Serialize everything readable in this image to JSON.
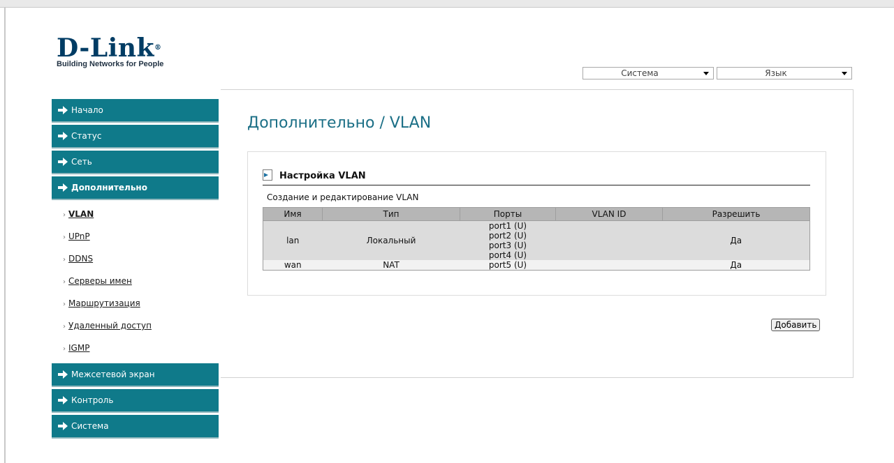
{
  "brand": {
    "name": "D-Link",
    "reg": "®",
    "tagline": "Building Networks for People"
  },
  "header": {
    "system_select": {
      "value": "Система"
    },
    "language_select": {
      "value": "Язык"
    }
  },
  "menu": {
    "home": "Начало",
    "status": "Статус",
    "network": "Сеть",
    "advanced": "Дополнительно",
    "advanced_items": [
      "VLAN",
      "UPnP",
      "DDNS",
      "Серверы имен",
      "Маршрутизация",
      "Удаленный доступ",
      "IGMP"
    ],
    "firewall": "Межсетевой экран",
    "control": "Контроль",
    "system": "Система"
  },
  "page": {
    "title": "Дополнительно / VLAN",
    "section_title": "Настройка VLAN",
    "section_desc": "Создание и редактирование VLAN",
    "add_button": "Добавить"
  },
  "table": {
    "headers": [
      "Имя",
      "Тип",
      "Порты",
      "VLAN ID",
      "Разрешить"
    ],
    "rows": [
      {
        "name": "lan",
        "type": "Локальный",
        "ports": [
          "port1 (U)",
          "port2 (U)",
          "port3 (U)",
          "port4 (U)"
        ],
        "vlan_id": "",
        "enabled": "Да"
      },
      {
        "name": "wan",
        "type": "NAT",
        "ports": [
          "port5 (U)"
        ],
        "vlan_id": "",
        "enabled": "Да"
      }
    ]
  },
  "colors": {
    "menu_bg": "#0f7a8a",
    "title": "#1b6f86",
    "logo": "#003c64"
  },
  "icons": {
    "menu_arrow": "arrow-right-icon",
    "section": "document-arrow-icon",
    "dropdown": "chevron-down-icon"
  }
}
